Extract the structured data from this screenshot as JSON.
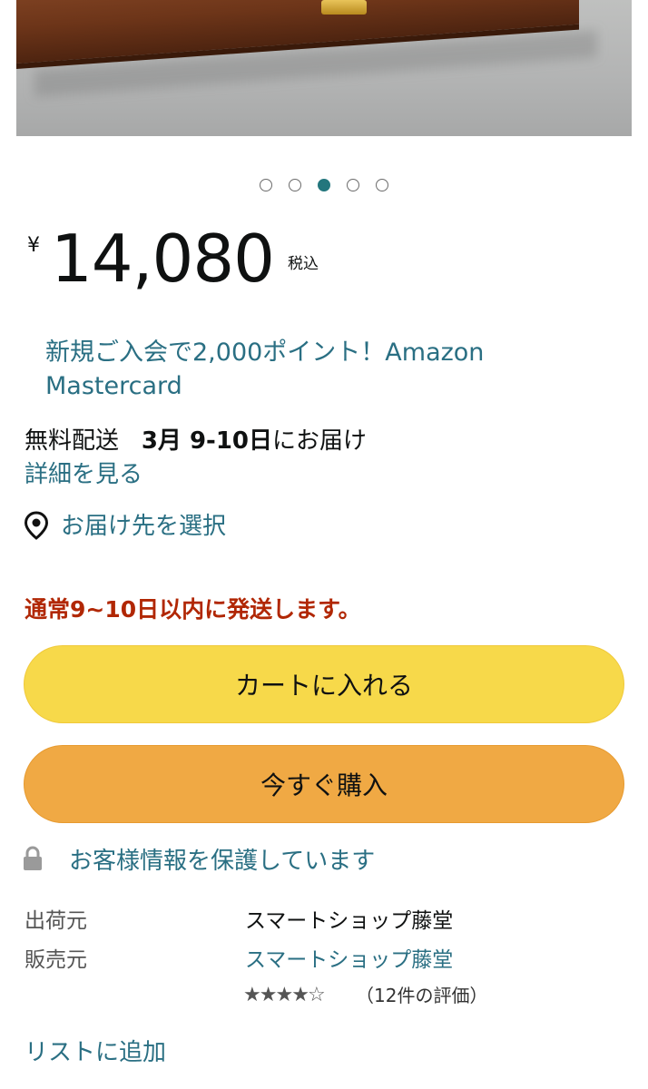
{
  "carousel": {
    "count": 5,
    "active_index": 2
  },
  "price": {
    "currency": "¥",
    "amount": "14,080",
    "tax_note": "税込"
  },
  "promo": {
    "text": "新規ご入会で2,000ポイント！Amazon Mastercard"
  },
  "delivery": {
    "prefix": "無料配送",
    "date": "3月 9-10日",
    "suffix": "にお届け",
    "details_link": "詳細を見る"
  },
  "location": {
    "label": "お届け先を選択"
  },
  "shipping_note": "通常9~10日以内に発送します。",
  "buttons": {
    "add_to_cart": "カートに入れる",
    "buy_now": "今すぐ購入"
  },
  "security": {
    "text": "お客様情報を保護しています"
  },
  "seller_info": {
    "ships_from_label": "出荷元",
    "ships_from_value": "スマートショップ藤堂",
    "sold_by_label": "販売元",
    "sold_by_value": "スマートショップ藤堂",
    "rating": 4,
    "rating_max": 5,
    "rating_count_text": "（12件の評価）"
  },
  "add_to_list": "リストに追加",
  "colors": {
    "link": "#2a6f83",
    "cart_button": "#f7d94a",
    "buy_button": "#f0a944",
    "shipping_note": "#b12704",
    "dot_active": "#23767d"
  }
}
